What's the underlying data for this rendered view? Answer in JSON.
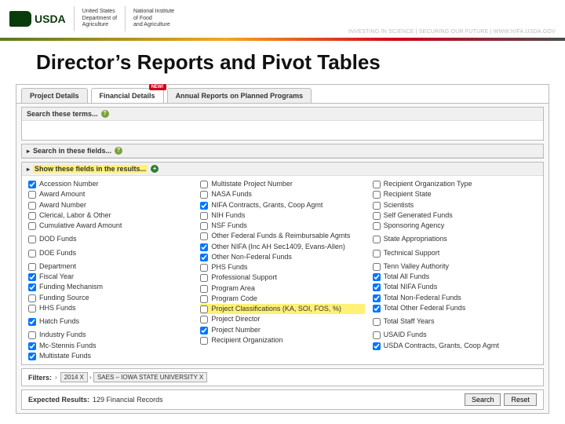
{
  "header": {
    "logo_text": "USDA",
    "org1": "United States\nDepartment of\nAgriculture",
    "org2": "National Institute\nof Food\nand Agriculture",
    "tagline": "INVESTING IN SCIENCE | SECURING OUR FUTURE | WWW.NIFA.USDA.GOV"
  },
  "title": "Director’s Reports and Pivot Tables",
  "tabs": [
    {
      "label": "Project Details",
      "active": false
    },
    {
      "label": "Financial Details",
      "active": true,
      "badge": "NEW!"
    },
    {
      "label": "Annual Reports on Planned Programs",
      "active": false
    }
  ],
  "sections": {
    "search_terms": {
      "label": "Search these terms...",
      "help": "?"
    },
    "search_fields": {
      "label": "Search in these fields...",
      "help": "?"
    },
    "show_fields": {
      "label": "Show these fields in the results...",
      "add": "+"
    }
  },
  "columns": [
    [
      {
        "label": "Accession Number",
        "checked": true
      },
      {
        "label": "Award Amount",
        "checked": false
      },
      {
        "label": "Award Number",
        "checked": false
      },
      {
        "label": "Clerical, Labor & Other",
        "checked": false
      },
      {
        "label": "Cumulative Award Amount",
        "checked": false
      },
      {
        "spacer": true
      },
      {
        "label": "DOD Funds",
        "checked": false
      },
      {
        "spacer": true
      },
      {
        "label": "DOE Funds",
        "checked": false
      },
      {
        "spacer": true
      },
      {
        "label": "Department",
        "checked": false
      },
      {
        "label": "Fiscal Year",
        "checked": true
      },
      {
        "label": "Funding Mechanism",
        "checked": true
      },
      {
        "label": "Funding Source",
        "checked": false
      },
      {
        "label": "HHS Funds",
        "checked": false
      },
      {
        "spacer": true
      },
      {
        "label": "Hatch Funds",
        "checked": true
      },
      {
        "spacer": true
      },
      {
        "label": "Industry Funds",
        "checked": false
      },
      {
        "label": "Mc-Stennis Funds",
        "checked": true
      },
      {
        "label": "Multistate Funds",
        "checked": true
      }
    ],
    [
      {
        "label": "Multistate Project Number",
        "checked": false
      },
      {
        "label": "NASA Funds",
        "checked": false
      },
      {
        "label": "NIFA Contracts, Grants, Coop Agmt",
        "checked": true
      },
      {
        "label": "NIH Funds",
        "checked": false
      },
      {
        "label": "NSF Funds",
        "checked": false
      },
      {
        "label": "Other Federal Funds & Reimbursable Agmts",
        "checked": false
      },
      {
        "label": "Other NIFA (Inc AH Sec1409, Evans-Allen)",
        "checked": true
      },
      {
        "label": "Other Non-Federal Funds",
        "checked": true
      },
      {
        "label": "PHS Funds",
        "checked": false
      },
      {
        "label": "Professional Support",
        "checked": false
      },
      {
        "label": "Program Area",
        "checked": false
      },
      {
        "label": "Program Code",
        "checked": false
      },
      {
        "label": "Project Classifications (KA, SOI, FOS, %)",
        "checked": false,
        "hl": true
      },
      {
        "label": "Project Director",
        "checked": false
      },
      {
        "label": "Project Number",
        "checked": true
      },
      {
        "label": "Recipient Organization",
        "checked": false
      }
    ],
    [
      {
        "label": "Recipient Organization Type",
        "checked": false
      },
      {
        "label": "Recipient State",
        "checked": false
      },
      {
        "label": "Scientists",
        "checked": false
      },
      {
        "label": "Self Generated Funds",
        "checked": false
      },
      {
        "label": "Sponsoring Agency",
        "checked": false
      },
      {
        "spacer": true
      },
      {
        "label": "State Appropriations",
        "checked": false
      },
      {
        "spacer": true
      },
      {
        "label": "Technical Support",
        "checked": false
      },
      {
        "spacer": true
      },
      {
        "label": "Tenn Valley Authority",
        "checked": false
      },
      {
        "label": "Total All Funds",
        "checked": true
      },
      {
        "label": "Total NIFA Funds",
        "checked": true
      },
      {
        "label": "Total Non-Federal Funds",
        "checked": true
      },
      {
        "label": "Total Other Federal Funds",
        "checked": true
      },
      {
        "spacer": true
      },
      {
        "label": "Total Staff Years",
        "checked": false
      },
      {
        "spacer": true
      },
      {
        "label": "USAID Funds",
        "checked": false
      },
      {
        "label": "USDA Contracts, Grants, Coop Agmt",
        "checked": true
      }
    ]
  ],
  "filters": {
    "label": "Filters:",
    "chips": [
      "2014",
      "SAES – IOWA STATE UNIVERSITY"
    ]
  },
  "results": {
    "label": "Expected Results:",
    "value": "129 Financial Records",
    "search_btn": "Search",
    "reset_btn": "Reset"
  }
}
